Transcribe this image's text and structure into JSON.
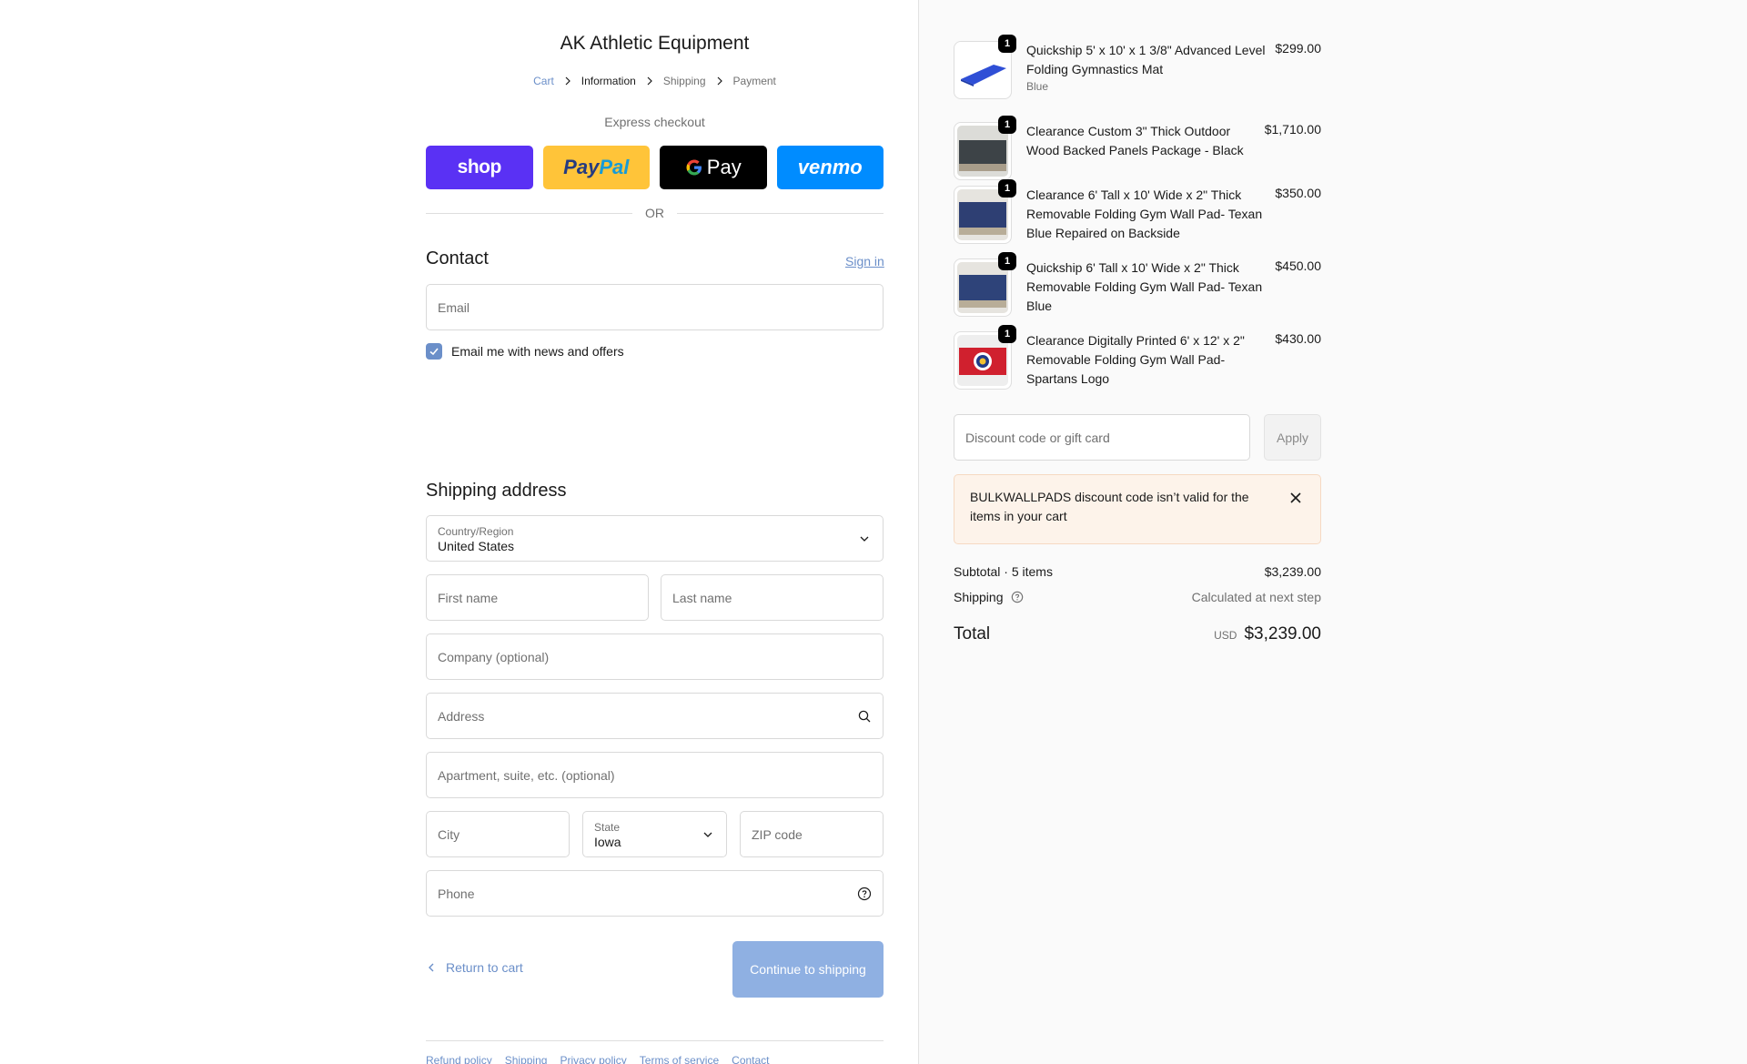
{
  "store": {
    "name": "AK Athletic Equipment"
  },
  "breadcrumb": [
    {
      "label": "Cart"
    },
    {
      "label": "Information"
    },
    {
      "label": "Shipping"
    },
    {
      "label": "Payment"
    }
  ],
  "express": {
    "title": "Express checkout",
    "shop_label": "shop",
    "paypal_part1": "Pay",
    "paypal_part2": "Pal",
    "gpay_label": "Pay",
    "venmo_label": "venmo",
    "or_label": "OR"
  },
  "contact": {
    "title": "Contact",
    "signin_label": "Sign in",
    "email_placeholder": "Email",
    "newsletter_label": "Email me with news and offers",
    "newsletter_checked": true
  },
  "shipping": {
    "title": "Shipping address",
    "country_label": "Country/Region",
    "country_value": "United States",
    "first_name_placeholder": "First name",
    "last_name_placeholder": "Last name",
    "company_placeholder": "Company (optional)",
    "address_placeholder": "Address",
    "apartment_placeholder": "Apartment, suite, etc. (optional)",
    "city_placeholder": "City",
    "state_label": "State",
    "state_value": "Iowa",
    "zip_placeholder": "ZIP code",
    "phone_placeholder": "Phone"
  },
  "actions": {
    "return_label": "Return to cart",
    "continue_label": "Continue to shipping"
  },
  "footer": {
    "links": [
      "Refund policy",
      "Shipping",
      "Privacy policy",
      "Terms of service",
      "Contact"
    ]
  },
  "cart": {
    "items": [
      {
        "qty": "1",
        "title": "Quickship 5' x 10' x 1 3/8\" Advanced Level Folding Gymnastics Mat",
        "variant": "Blue",
        "price": "$299.00"
      },
      {
        "qty": "1",
        "title": "Clearance Custom 3\" Thick Outdoor Wood Backed Panels Package - Black",
        "variant": "",
        "price": "$1,710.00"
      },
      {
        "qty": "1",
        "title": "Clearance 6' Tall x 10' Wide x 2\" Thick Removable Folding Gym Wall Pad- Texan Blue Repaired on Backside",
        "variant": "",
        "price": "$350.00"
      },
      {
        "qty": "1",
        "title": "Quickship 6' Tall x 10' Wide x 2\" Thick Removable Folding Gym Wall Pad- Texan Blue",
        "variant": "",
        "price": "$450.00"
      },
      {
        "qty": "1",
        "title": "Clearance Digitally Printed 6' x 12' x 2\" Removable Folding Gym Wall Pad- Spartans Logo",
        "variant": "",
        "price": "$430.00"
      }
    ],
    "discount_placeholder": "Discount code or gift card",
    "apply_label": "Apply",
    "error_message": "BULKWALLPADS discount code isn’t valid for the items in your cart",
    "subtotal_label": "Subtotal · 5 items",
    "subtotal_value": "$3,239.00",
    "shipping_label": "Shipping",
    "shipping_value": "Calculated at next step",
    "total_label": "Total",
    "currency": "USD",
    "total_value": "$3,239.00"
  },
  "colors": {
    "accent": "#6b8fc9",
    "continue_button": "#8fb0e2",
    "shop_pay": "#5a31f4",
    "paypal": "#ffc439",
    "venmo": "#008cff",
    "error_bg": "#fdf3ea"
  }
}
